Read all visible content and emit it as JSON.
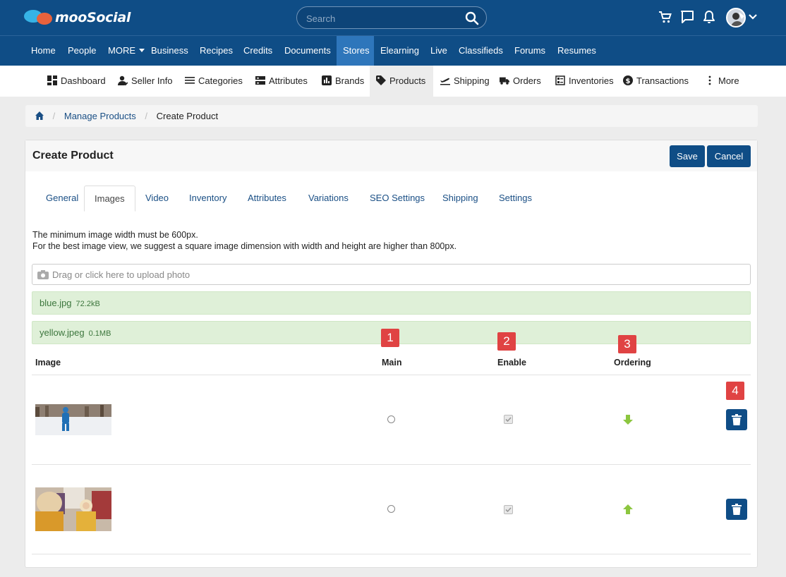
{
  "app": {
    "logo_text": "mooSocial"
  },
  "search": {
    "placeholder": "Search"
  },
  "main_nav": [
    "Home",
    "People",
    "MORE",
    "Business",
    "Recipes",
    "Credits",
    "Documents",
    "Stores",
    "Elearning",
    "Live",
    "Classifieds",
    "Forums",
    "Resumes"
  ],
  "main_nav_active": "Stores",
  "store_nav": [
    {
      "label": "Dashboard",
      "icon": "dashboard-icon"
    },
    {
      "label": "Seller Info",
      "icon": "user-icon"
    },
    {
      "label": "Categories",
      "icon": "list-icon"
    },
    {
      "label": "Attributes",
      "icon": "attributes-icon"
    },
    {
      "label": "Brands",
      "icon": "brands-icon"
    },
    {
      "label": "Products",
      "icon": "tag-icon"
    },
    {
      "label": "Shipping",
      "icon": "plane-icon"
    },
    {
      "label": "Orders",
      "icon": "truck-icon"
    },
    {
      "label": "Inventories",
      "icon": "inventory-icon"
    },
    {
      "label": "Transactions",
      "icon": "dollar-icon"
    },
    {
      "label": "More",
      "icon": "more-vertical-icon"
    }
  ],
  "store_nav_active": "Products",
  "breadcrumb": {
    "link": "Manage Products",
    "current": "Create Product"
  },
  "panel": {
    "title": "Create Product",
    "save_label": "Save",
    "cancel_label": "Cancel"
  },
  "tabs": [
    "General",
    "Images",
    "Video",
    "Inventory",
    "Attributes",
    "Variations",
    "SEO Settings",
    "Shipping",
    "Settings"
  ],
  "active_tab": "Images",
  "note": {
    "line1": "The minimum image width must be 600px.",
    "line2": "For the best image view, we suggest a square image dimension with width and height are higher than 800px."
  },
  "upload": {
    "placeholder": "Drag or click here to upload photo"
  },
  "files": [
    {
      "name": "blue.jpg",
      "size": "72.2kB"
    },
    {
      "name": "yellow.jpeg",
      "size": "0.1MB"
    }
  ],
  "table": {
    "headers": {
      "image": "Image",
      "main": "Main",
      "enable": "Enable",
      "ordering": "Ordering"
    },
    "rows": [
      {
        "main": false,
        "enabled": true,
        "ordering": "down"
      },
      {
        "main": false,
        "enabled": true,
        "ordering": "up"
      }
    ]
  },
  "badges": [
    "1",
    "2",
    "3",
    "4"
  ],
  "colors": {
    "brand": "#0f4d86",
    "badge": "#e04343",
    "success_bg": "#dff0d8",
    "arrow": "#8cc63f"
  }
}
